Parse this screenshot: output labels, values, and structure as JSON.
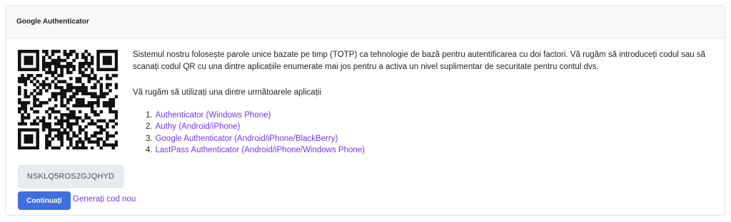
{
  "card": {
    "title": "Google Authenticator"
  },
  "qr": {
    "icon": "qr-code-icon",
    "secret": "NSKLQ5ROS2GJQHYD"
  },
  "description": "Sistemul nostru folosește parole unice bazate pe timp (TOTP) ca tehnologie de bază pentru autentificarea cu doi factori. Vă rugăm să introduceți codul sau să scanați codul QR cu una dintre aplicațiile enumerate mai jos pentru a activa un nivel suplimentar de securitate pentru contul dvs.",
  "apps_intro": "Vă rugăm să utilizați una dintre următoarele aplicații",
  "apps": [
    {
      "num": "1.",
      "label": "Authenticator (Windows Phone)"
    },
    {
      "num": "2.",
      "label": "Authy (Android/iPhone)"
    },
    {
      "num": "3.",
      "label": "Google Authenticator (Android/iPhone/BlackBerry)"
    },
    {
      "num": "4.",
      "label": "LastPass Authenticator (Android/iPhone/Windows Phone)"
    }
  ],
  "actions": {
    "continue_label": "Continuați",
    "new_code_label": "Generați cod nou"
  },
  "colors": {
    "primary": "#3f6ee0",
    "link": "#7239ea"
  }
}
